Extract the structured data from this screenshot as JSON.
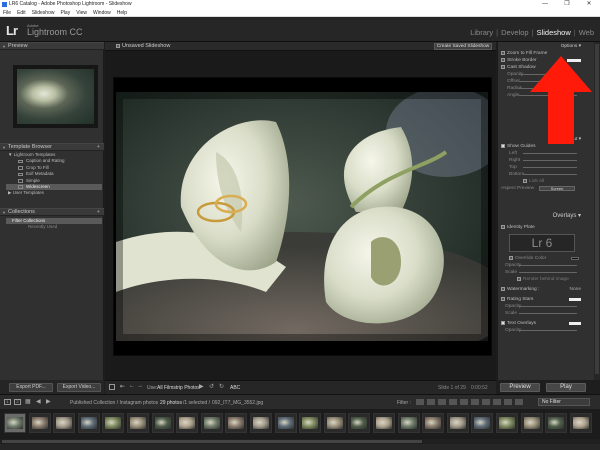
{
  "window": {
    "title": "LR6 Catalog - Adobe Photoshop Lightroom - Slideshow",
    "controls": [
      "—",
      "❐",
      "✕"
    ]
  },
  "menu": [
    "File",
    "Edit",
    "Slideshow",
    "Play",
    "View",
    "Window",
    "Help"
  ],
  "identity": {
    "logo": "Lr",
    "brand_small": "Adobe",
    "brand_large": "Lightroom CC"
  },
  "modules": [
    {
      "label": "Library",
      "active": false
    },
    {
      "label": "Develop",
      "active": false
    },
    {
      "label": "Slideshow",
      "active": true
    },
    {
      "label": "Web",
      "active": false
    }
  ],
  "left_panel": {
    "preview_header": "Preview",
    "template_header": "Template Browser",
    "templates_folder": "Lightroom Templates",
    "templates": [
      {
        "label": "Caption and Rating",
        "selected": false
      },
      {
        "label": "Crop To Fill",
        "selected": false
      },
      {
        "label": "Exif Metadata",
        "selected": false
      },
      {
        "label": "Simple",
        "selected": false
      },
      {
        "label": "Widescreen",
        "selected": true
      }
    ],
    "user_folder": "User Templates",
    "collections_header": "Collections",
    "collections": [
      "Filter Collections",
      "Recently Used"
    ],
    "export_pdf": "Export PDF...",
    "export_video": "Export Video..."
  },
  "center": {
    "doc_title": "Unsaved Slideshow",
    "create_saved": "Create Saved Slideshow",
    "toolbar": {
      "use_label": "Use:",
      "use_value": "All Filmstrip Photos",
      "abc": "ABC",
      "slide_counter": "Slide 1 of 29",
      "duration": "0:00:52"
    }
  },
  "right_panel": {
    "options_header": "Options",
    "options_zoom": "Zoom to Fill Frame",
    "options_stroke": "Stroke Border",
    "options_cast": "Cast Shadow",
    "shadow_rows": [
      "Opacity",
      "Offset",
      "Radius",
      "Angle"
    ],
    "layout_header": "Layout",
    "show_guides": "Show Guides",
    "guide_rows": [
      "Left",
      "Right",
      "Top",
      "Bottom"
    ],
    "link_all": "Link All",
    "aspect_label": "Aspect Preview",
    "aspect_value": "Screen",
    "overlays_header": "Overlays",
    "identity_plate": "Identity Plate",
    "plate_text": "Lr 6",
    "override_color": "Override Color",
    "overlay_rows": [
      "Opacity",
      "Scale"
    ],
    "render_behind": "Render behind image",
    "watermarking": "Watermarking :",
    "watermark_value": "None",
    "rating_stars": "Rating Stars",
    "star_rows": [
      "Opacity",
      "Scale"
    ],
    "text_overlays": "Text Overlays",
    "text_rows": [
      "Opacity"
    ],
    "preview_btn": "Preview",
    "play_btn": "Play"
  },
  "filmstrip": {
    "pages": [
      "1",
      "2"
    ],
    "source": "Published Collection / Instagram photos",
    "count": "29 photos",
    "selected": "/1 selected /",
    "filename": "092_IT7_MG_3552.jpg",
    "filter_label": "Filter :",
    "filter_value": "No Filter",
    "thumbs": 24
  },
  "colors": {
    "accent_arrow": "#ff1a0a",
    "panel_bg": "#303030",
    "active_module": "#f2f2f2"
  }
}
